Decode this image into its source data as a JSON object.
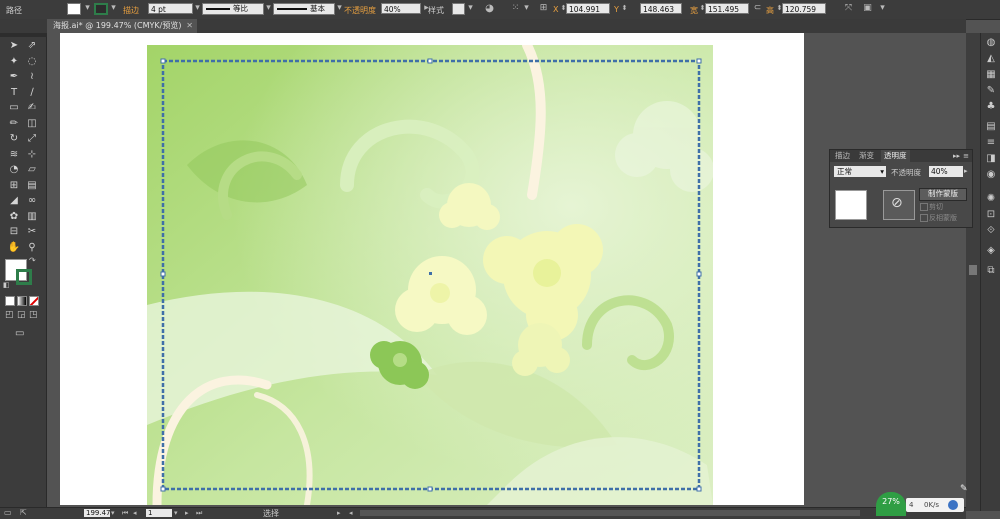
{
  "control_bar": {
    "object_type": "路径",
    "stroke_label": "描边",
    "stroke_weight": "4 pt",
    "variable_width_label": "等比",
    "brush_label": "基本",
    "opacity_label": "不透明度",
    "opacity_value": "40%",
    "style_label": "样式",
    "x_label": "X",
    "x_value": "104.991",
    "y_label": "Y",
    "y_value": "148.463",
    "w_label": "宽",
    "w_value": "151.495",
    "h_label": "高",
    "h_value": "120.759"
  },
  "document": {
    "tab_title": "海报.ai* @ 199.47% (CMYK/预览)"
  },
  "transparency_panel": {
    "tabs": [
      "描边",
      "渐变",
      "透明度"
    ],
    "blend_mode": "正常",
    "opacity_label": "不透明度",
    "opacity_value": "40%",
    "make_mask_button": "制作蒙版",
    "clip_label": "剪切",
    "invert_mask_label": "反相蒙版"
  },
  "status_bar": {
    "zoom": "199.47",
    "artboard_number": "1",
    "tool_status": "选择"
  },
  "network_widget": {
    "percent": "27%",
    "speed": "0K/s",
    "count": "4"
  },
  "colors": {
    "ui_dark": "#3c3c3c",
    "canvas_gray": "#535353",
    "artwork_green": "#a6d56a",
    "selection_blue": "#3f6fa8",
    "accent_orange": "#e8a040"
  },
  "icons": {
    "tools": [
      "selection-tool-icon",
      "direct-selection-tool-icon",
      "magic-wand-tool-icon",
      "lasso-tool-icon",
      "pen-tool-icon",
      "curvature-tool-icon",
      "type-tool-icon",
      "line-tool-icon",
      "rectangle-tool-icon",
      "paintbrush-tool-icon",
      "pencil-tool-icon",
      "eraser-tool-icon",
      "rotate-tool-icon",
      "scale-tool-icon",
      "warp-tool-icon",
      "free-transform-tool-icon",
      "shape-builder-tool-icon",
      "perspective-tool-icon",
      "mesh-tool-icon",
      "gradient-tool-icon",
      "eyedropper-tool-icon",
      "blend-tool-icon",
      "symbol-sprayer-tool-icon",
      "column-graph-tool-icon",
      "artboard-tool-icon",
      "slice-tool-icon",
      "hand-tool-icon",
      "zoom-tool-icon"
    ]
  }
}
